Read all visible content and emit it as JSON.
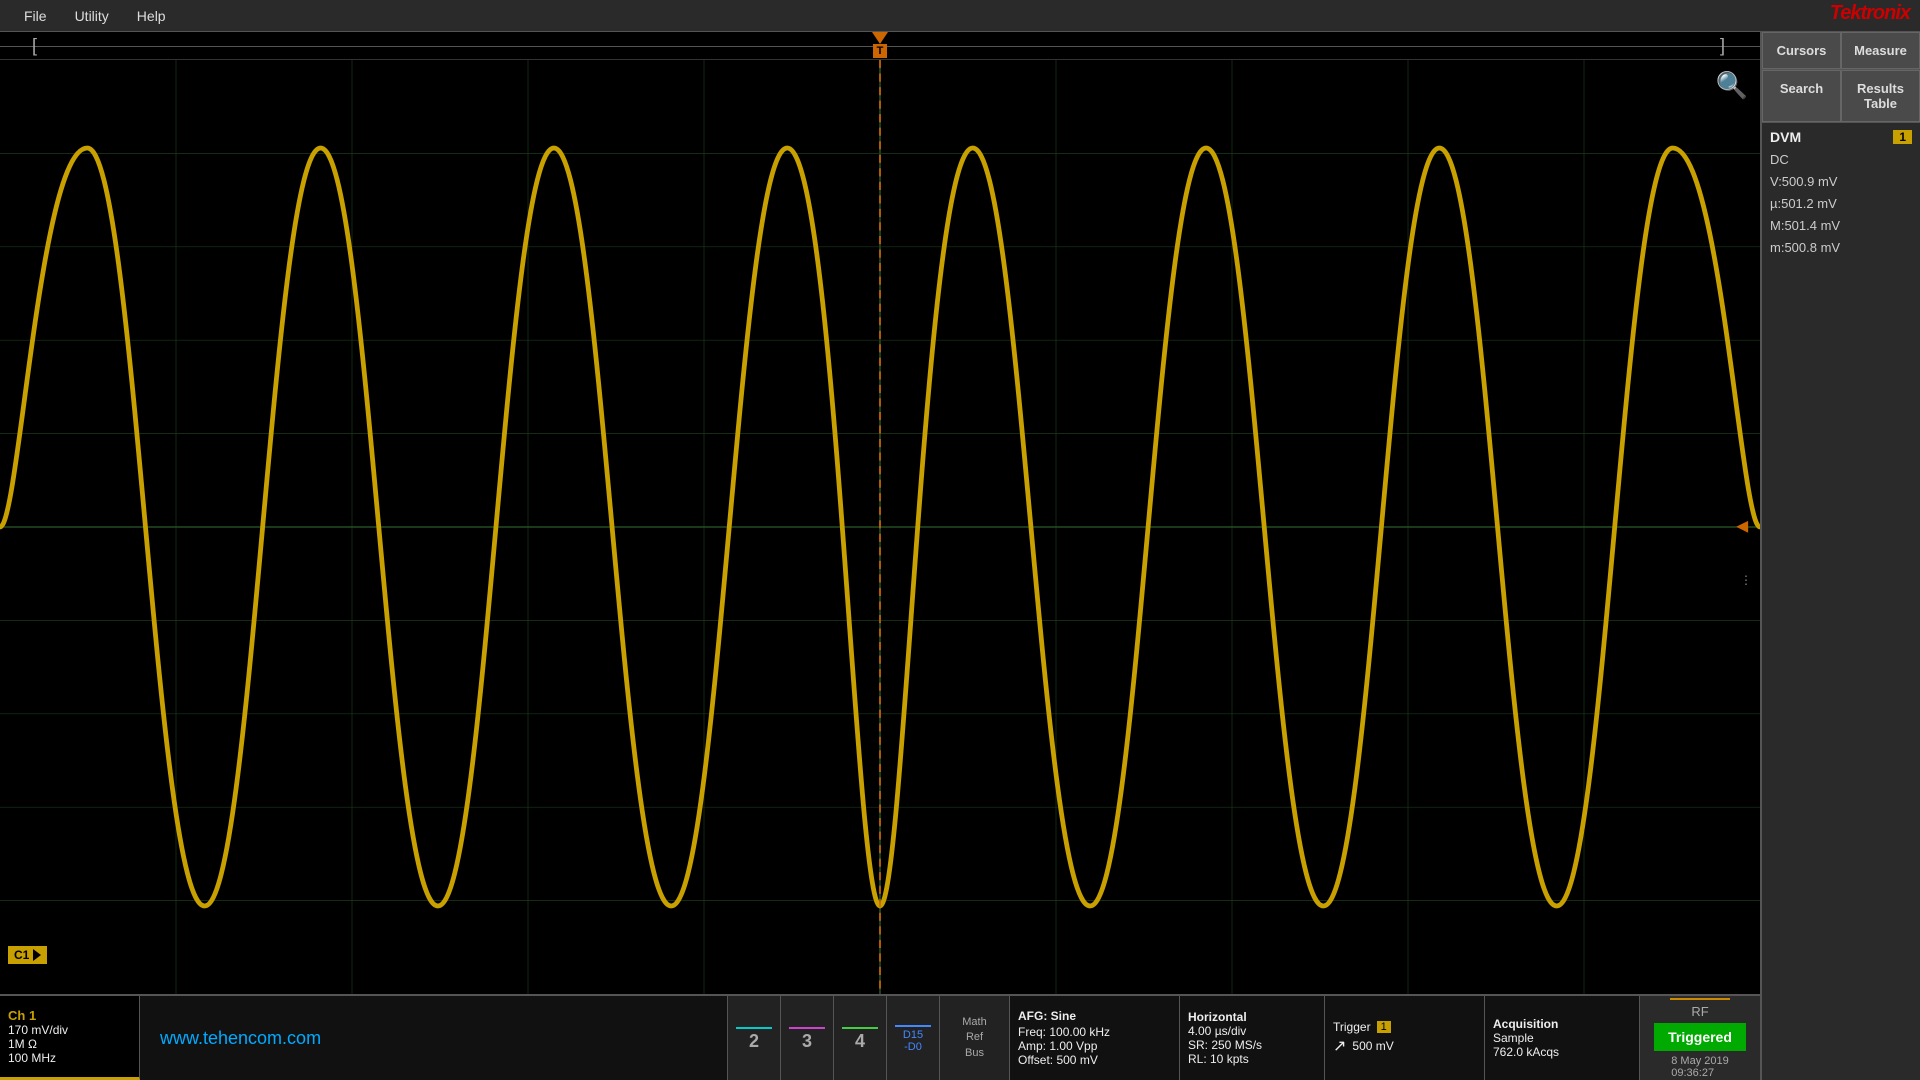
{
  "menu": {
    "items": [
      "File",
      "Utility",
      "Help"
    ]
  },
  "logo": "Tektronix",
  "trigger": {
    "bracket_left": "[",
    "bracket_right": "]",
    "label": "T",
    "arrow": "◄",
    "three_dot": "⋮"
  },
  "waveform": {
    "color": "#c8a000",
    "type": "sine"
  },
  "ch1_label": "C1",
  "magnifier": "🔍",
  "bottom": {
    "ch1": {
      "name": "Ch 1",
      "vdiv": "170 mV/div",
      "impedance": "1M Ω",
      "bandwidth": "100 MHz"
    },
    "website": "www.tehencom.com",
    "ch2": {
      "num": "2",
      "color": "#00cccc"
    },
    "ch3": {
      "num": "3",
      "color": "#cc44cc"
    },
    "ch4": {
      "num": "4",
      "color": "#44cc44"
    },
    "d15d0": {
      "label": "D15\n-D0",
      "color": "#4488ff"
    },
    "math_ref_bus": {
      "line1": "Math",
      "line2": "Ref",
      "line3": "Bus"
    },
    "afg": {
      "title": "AFG: Sine",
      "freq": "Freq: 100.00 kHz",
      "amp": "Amp: 1.00 Vpp",
      "offset": "Offset: 500 mV"
    },
    "horizontal": {
      "title": "Horizontal",
      "time_div": "4.00 µs/div",
      "sample_rate": "SR: 250 MS/s",
      "record_length": "RL: 10 kpts"
    },
    "trigger": {
      "title": "Trigger",
      "badge": "1",
      "slope": "↗",
      "level": "500 mV"
    },
    "acquisition": {
      "title": "Acquisition",
      "mode": "Sample",
      "acqs": "762.0 kAcqs"
    },
    "rf": {
      "label": "RF"
    },
    "triggered": {
      "label": "Triggered"
    },
    "datetime": {
      "date": "8 May 2019",
      "time": "09:36:27"
    }
  },
  "right_panel": {
    "cursors_btn": "Cursors",
    "measure_btn": "Measure",
    "search_btn": "Search",
    "results_table_btn": "Results\nTable",
    "dvm": {
      "title": "DVM",
      "badge": "1",
      "mode": "DC",
      "v": "V:500.9 mV",
      "mu": "µ:501.2 mV",
      "m_upper": "M:501.4 mV",
      "m_lower": "m:500.8 mV"
    }
  }
}
